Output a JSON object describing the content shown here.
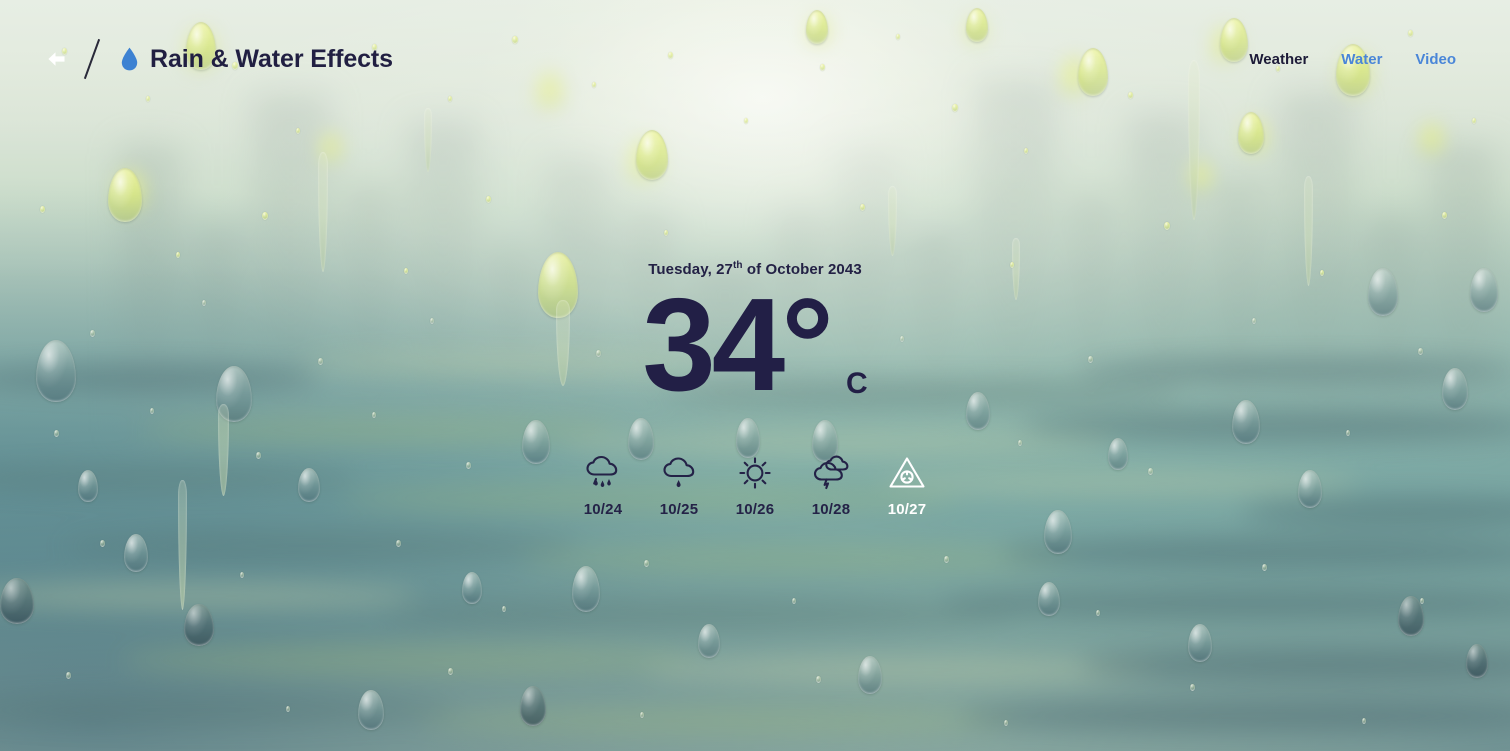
{
  "header": {
    "back_icon": "back-arrow-icon",
    "divider": "slash-divider",
    "logo_icon": "water-drop-icon",
    "title": "Rain & Water Effects",
    "nav": [
      {
        "label": "Weather",
        "state": "dark"
      },
      {
        "label": "Water",
        "state": "blue"
      },
      {
        "label": "Video",
        "state": "blue"
      }
    ]
  },
  "weather": {
    "date": {
      "prefix": "Tuesday, 27",
      "ordinal": "th",
      "suffix": " of October 2043"
    },
    "temperature": "34°",
    "unit": "C",
    "forecast": [
      {
        "label": "10/24",
        "icon": "rain-cloud-icon",
        "active": false
      },
      {
        "label": "10/25",
        "icon": "drizzle-cloud-icon",
        "active": false
      },
      {
        "label": "10/26",
        "icon": "sun-icon",
        "active": false
      },
      {
        "label": "10/28",
        "icon": "storm-cloud-icon",
        "active": false
      },
      {
        "label": "10/27",
        "icon": "warning-triangle-icon",
        "active": true
      }
    ]
  },
  "colors": {
    "title_navy": "#211f42",
    "nav_blue": "#4a86d8",
    "drop_blue": "#3d82d2",
    "active_white": "#ffffff",
    "bg_top": "#e3ebdf",
    "bg_bottom": "#8fb6a8"
  }
}
